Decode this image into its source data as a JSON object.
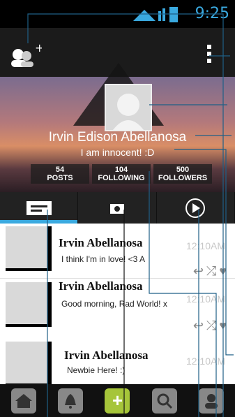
{
  "status": {
    "time": "9:25"
  },
  "profile": {
    "name": "Irvin Edison Abellanosa",
    "bio": "I am innocent! :D",
    "stats": [
      {
        "num": "54",
        "label": "POSTS"
      },
      {
        "num": "104",
        "label": "FOLLOWING"
      },
      {
        "num": "500",
        "label": "FOLLOWERS"
      }
    ]
  },
  "tabs": [
    "chat-icon",
    "camera-icon",
    "play-icon"
  ],
  "posts": [
    {
      "name": "Irvin Abellanosa",
      "text": "I think I'm in love! <3 A",
      "time": "12:10AM"
    },
    {
      "name": "Irvin Abellanosa",
      "text": "Good morning, Rad World! x",
      "time": "12:10AM"
    },
    {
      "name": "Irvin Abellanosa",
      "text": "Newbie Here! :)",
      "time": "12:10AM"
    }
  ],
  "colors": {
    "accent": "#3aa9df",
    "add": "#a6c53a"
  }
}
